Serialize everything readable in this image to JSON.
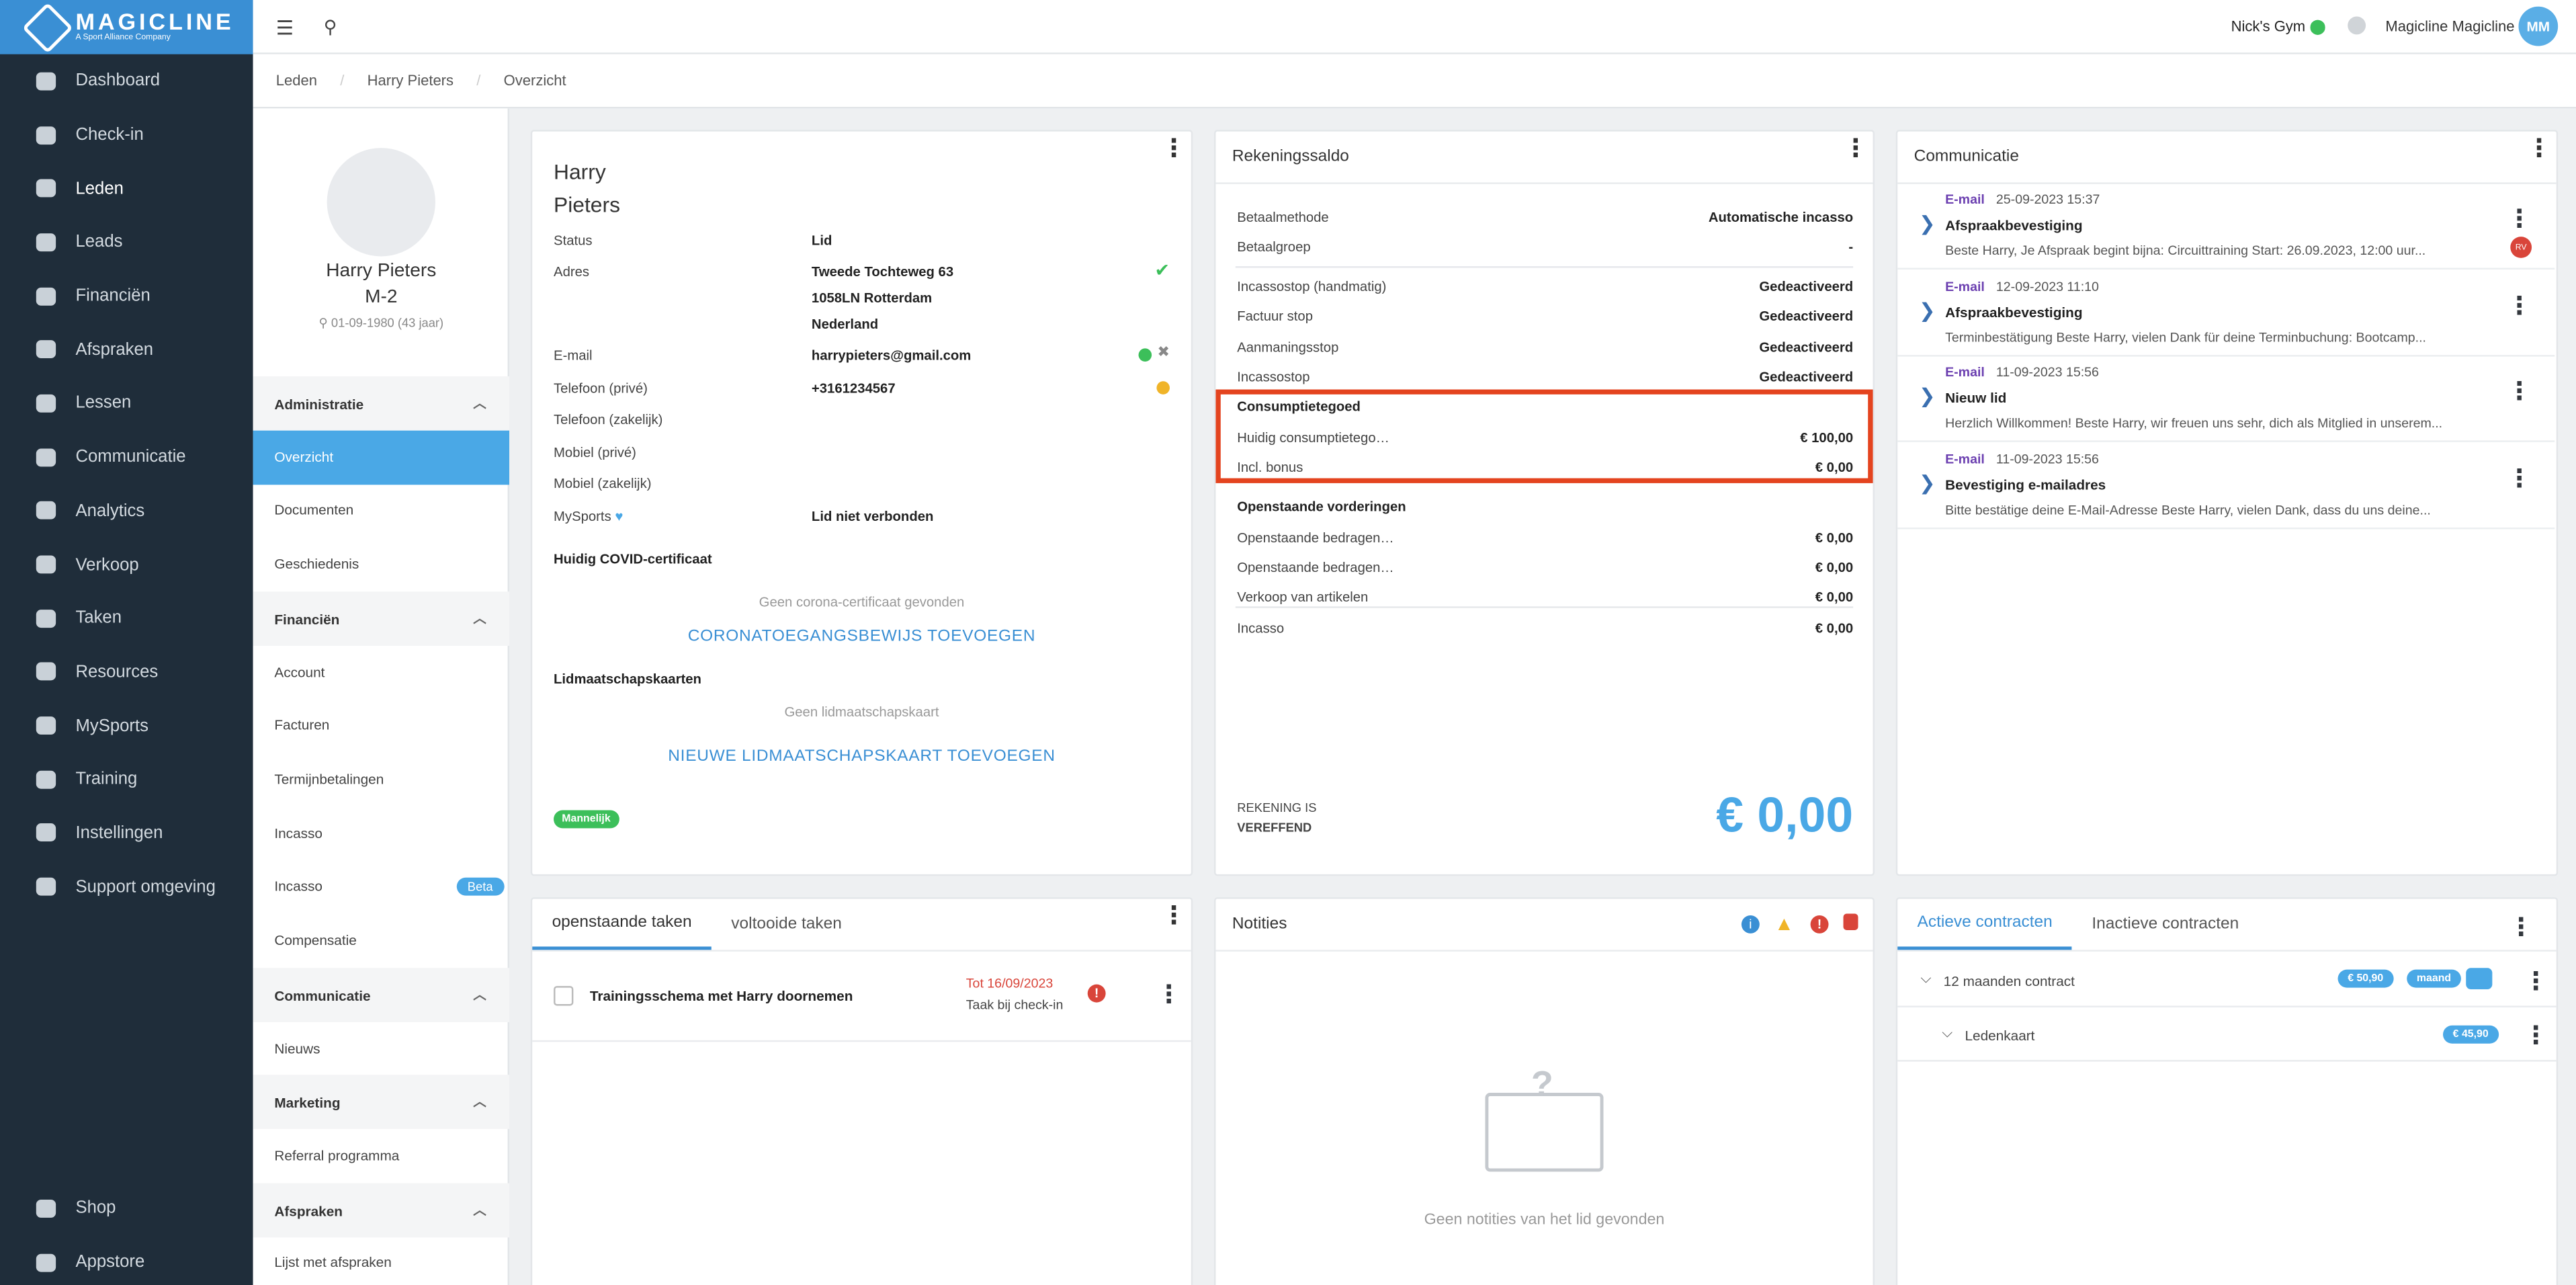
{
  "brand": {
    "name": "MAGICLINE",
    "tagline": "A Sport Alliance Company"
  },
  "nav": [
    {
      "label": "Dashboard",
      "icon": "dashboard-icon"
    },
    {
      "label": "Check-in",
      "icon": "checkin-icon"
    },
    {
      "label": "Leden",
      "icon": "members-icon"
    },
    {
      "label": "Leads",
      "icon": "leads-icon"
    },
    {
      "label": "Financiën",
      "icon": "finance-icon"
    },
    {
      "label": "Afspraken",
      "icon": "calendar-icon"
    },
    {
      "label": "Lessen",
      "icon": "classes-icon"
    },
    {
      "label": "Communicatie",
      "icon": "chat-icon"
    },
    {
      "label": "Analytics",
      "icon": "analytics-icon"
    },
    {
      "label": "Verkoop",
      "icon": "cart-icon"
    },
    {
      "label": "Taken",
      "icon": "tasks-icon"
    },
    {
      "label": "Resources",
      "icon": "resources-icon"
    },
    {
      "label": "MySports",
      "icon": "mysports-icon"
    },
    {
      "label": "Training",
      "icon": "training-icon"
    },
    {
      "label": "Instellingen",
      "icon": "settings-icon"
    },
    {
      "label": "Support omgeving",
      "icon": "support-icon"
    }
  ],
  "nav_bottom": [
    {
      "label": "Shop",
      "icon": "shop-icon"
    },
    {
      "label": "Appstore",
      "icon": "appstore-icon"
    }
  ],
  "header": {
    "gym": "Nick's Gym",
    "user": "Magicline Magicline",
    "initials": "MM"
  },
  "breadcrumb": [
    "Leden",
    "Harry Pieters",
    "Overzicht"
  ],
  "profile": {
    "name": "Harry Pieters",
    "code": "M-2",
    "dob": "01-09-1980 (43 jaar)"
  },
  "subnav": {
    "administratie": "Administratie",
    "overzicht": "Overzicht",
    "documenten": "Documenten",
    "geschiedenis": "Geschiedenis",
    "financien": "Financiën",
    "account": "Account",
    "facturen": "Facturen",
    "termijn": "Termijnbetalingen",
    "incasso1": "Incasso",
    "incasso2": "Incasso",
    "beta": "Beta",
    "compensatie": "Compensatie",
    "communicatie": "Communicatie",
    "nieuws": "Nieuws",
    "marketing": "Marketing",
    "referral": "Referral programma",
    "afspraken": "Afspraken",
    "lijst": "Lijst met afspraken"
  },
  "member": {
    "first": "Harry",
    "last": "Pieters",
    "status_l": "Status",
    "status_v": "Lid",
    "adres_l": "Adres",
    "adres1": "Tweede Tochteweg 63",
    "adres2": "1058LN Rotterdam",
    "adres3": "Nederland",
    "email_l": "E-mail",
    "email_v": "harrypieters@gmail.com",
    "tel_l": "Telefoon (privé)",
    "tel_v": "+3161234567",
    "telz_l": "Telefoon (zakelijk)",
    "mob_l": "Mobiel (privé)",
    "mobz_l": "Mobiel (zakelijk)",
    "mysports_l": "MySports",
    "mysports_v": "Lid niet verbonden",
    "covid_h": "Huidig COVID-certificaat",
    "covid_empty": "Geen corona-certificaat gevonden",
    "covid_add": "CORONATOEGANGSBEWIJS TOEVOEGEN",
    "cards_h": "Lidmaatschapskaarten",
    "cards_empty": "Geen lidmaatschapskaart",
    "cards_add": "NIEUWE LIDMAATSCHAPSKAART TOEVOEGEN",
    "gender": "Mannelijk"
  },
  "saldo": {
    "title": "Rekeningssaldo",
    "betaalmethode_l": "Betaalmethode",
    "betaalmethode_v": "Automatische incasso",
    "betaalgroep_l": "Betaalgroep",
    "betaalgroep_v": "-",
    "r1_l": "Incassostop (handmatig)",
    "r1_v": "Gedeactiveerd",
    "r2_l": "Factuur stop",
    "r2_v": "Gedeactiveerd",
    "r3_l": "Aanmaningsstop",
    "r3_v": "Gedeactiveerd",
    "r4_l": "Incassostop",
    "r4_v": "Gedeactiveerd",
    "cons_h": "Consumptietegoed",
    "cons1_l": "Huidig consumptietego…",
    "cons1_v": "€ 100,00",
    "cons2_l": "Incl. bonus",
    "cons2_v": "€ 0,00",
    "open_h": "Openstaande vorderingen",
    "o1_l": "Openstaande bedragen…",
    "o1_v": "€ 0,00",
    "o2_l": "Openstaande bedragen…",
    "o2_v": "€ 0,00",
    "o3_l": "Verkoop van artikelen",
    "o3_v": "€ 0,00",
    "o4_l": "Incasso",
    "o4_v": "€ 0,00",
    "status1": "REKENING IS",
    "status2": "VEREFFEND",
    "total": "€ 0,00"
  },
  "comm": {
    "title": "Communicatie",
    "items": [
      {
        "type": "E-mail",
        "date": "25-09-2023 15:37",
        "subject": "Afspraakbevestiging",
        "preview": "Beste Harry, Je Afspraak begint bijna: Circuittraining Start: 26.09.2023, 12:00 uur..."
      },
      {
        "type": "E-mail",
        "date": "12-09-2023 11:10",
        "subject": "Afspraakbevestiging",
        "preview": "Terminbestätigung Beste Harry, vielen Dank für deine Terminbuchung: Bootcamp..."
      },
      {
        "type": "E-mail",
        "date": "11-09-2023 15:56",
        "subject": "Nieuw lid",
        "preview": "Herzlich Willkommen! Beste Harry, wir freuen uns sehr, dich als Mitglied in unserem..."
      },
      {
        "type": "E-mail",
        "date": "11-09-2023 15:56",
        "subject": "Bevestiging e-mailadres",
        "preview": "Bitte bestätige deine E-Mail-Adresse Beste Harry, vielen Dank, dass du uns deine..."
      }
    ],
    "rv": "RV"
  },
  "tasks": {
    "tab1": "openstaande taken",
    "tab2": "voltooide taken",
    "item": "Trainingsschema met Harry doornemen",
    "due": "Tot 16/09/2023",
    "sub": "Taak bij check-in"
  },
  "notes": {
    "title": "Notities",
    "empty": "Geen notities van het lid gevonden"
  },
  "contracts": {
    "tab1": "Actieve contracten",
    "tab2": "Inactieve contracten",
    "c1": "12 maanden contract",
    "c1_price": "€ 50,90",
    "c1_period": "maand",
    "c2": "Ledenkaart",
    "c2_price": "€ 45,90"
  },
  "colors": {
    "accent": "#4aa8e6",
    "sidebar": "#1f2d3a",
    "highlight": "#e4441f"
  }
}
